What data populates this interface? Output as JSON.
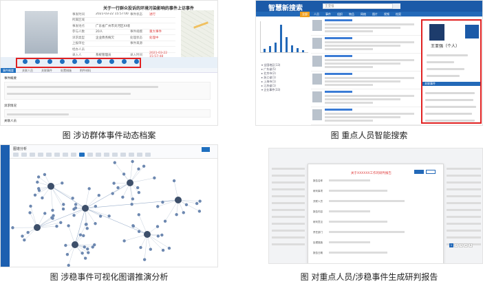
{
  "captions": {
    "p1": "图  涉访群体事件动态档案",
    "p2": "图  重点人员智能搜索",
    "p3": "图  涉稳事件可视化图谱推演分析",
    "p4": "图  对重点人员/涉稳事件生成研判报告"
  },
  "p1": {
    "title": "关于一行群众投诉的环境污染影响的事件上访事件",
    "info_rows": [
      {
        "label": "事发时间",
        "value": "2021-03-22 15:57:00",
        "label2": "事件状态",
        "value2": "进行"
      },
      {
        "label": "所属区域",
        "value": "",
        "label2": "",
        "value2": ""
      },
      {
        "label": "事发地点",
        "value": "广东省广州市天河区XX街道",
        "label2": "",
        "value2": ""
      },
      {
        "label": "参与人数",
        "value": "20人",
        "label2": "事件规模",
        "value2": "重大事件"
      },
      {
        "label": "诉求类型",
        "value": "企业债务拖欠",
        "label2": "处理状态",
        "value2": "处理中"
      },
      {
        "label": "上报单位",
        "value": "",
        "label2": "事件来源",
        "value2": ""
      },
      {
        "label": "经办人员",
        "value": "",
        "label2": "",
        "value2": ""
      },
      {
        "label": "录入人",
        "value": "系统管理员",
        "label2": "录入时间",
        "value2": "2021-03-22 15:57:48"
      }
    ],
    "tabs": [
      "事件概要",
      "关联人员",
      "关联事件",
      "处置措施",
      "附件材料"
    ],
    "sections": [
      "事件概要",
      "诉求情况",
      "关联人员"
    ]
  },
  "p2": {
    "brand": "智慧新搜索",
    "search_value": "王亚强",
    "nav": [
      "全部",
      "人员",
      "事件",
      "组织",
      "物品",
      "网络",
      "图片",
      "视频",
      "档案"
    ],
    "person_name": "王亚强（个人）",
    "right_section": "关联事件",
    "tree": [
      "▾ 全国地区(13)",
      "  ▸ 广东省(5)",
      "  ▸ 北京市(2)",
      "  ▸ 浙江省(1)",
      "  ▸ 上海市(1)",
      "  ▸ 江苏省(1)",
      "▾ 企业事件(33)"
    ]
  },
  "p3": {
    "title": "图谱分析"
  },
  "p4": {
    "dialog_title": "关于XXXXXX工作的研判报告",
    "fields": [
      "报告名称",
      "研判事项",
      "关联人员",
      "报告内容",
      "研判意见",
      "责任部门",
      "处理措施",
      "报告日期"
    ],
    "pages": [
      "1",
      "2",
      "3",
      "4",
      "5"
    ]
  },
  "colors": {
    "highlight_box": "#e02020",
    "primary_blue": "#1b5aa8"
  }
}
